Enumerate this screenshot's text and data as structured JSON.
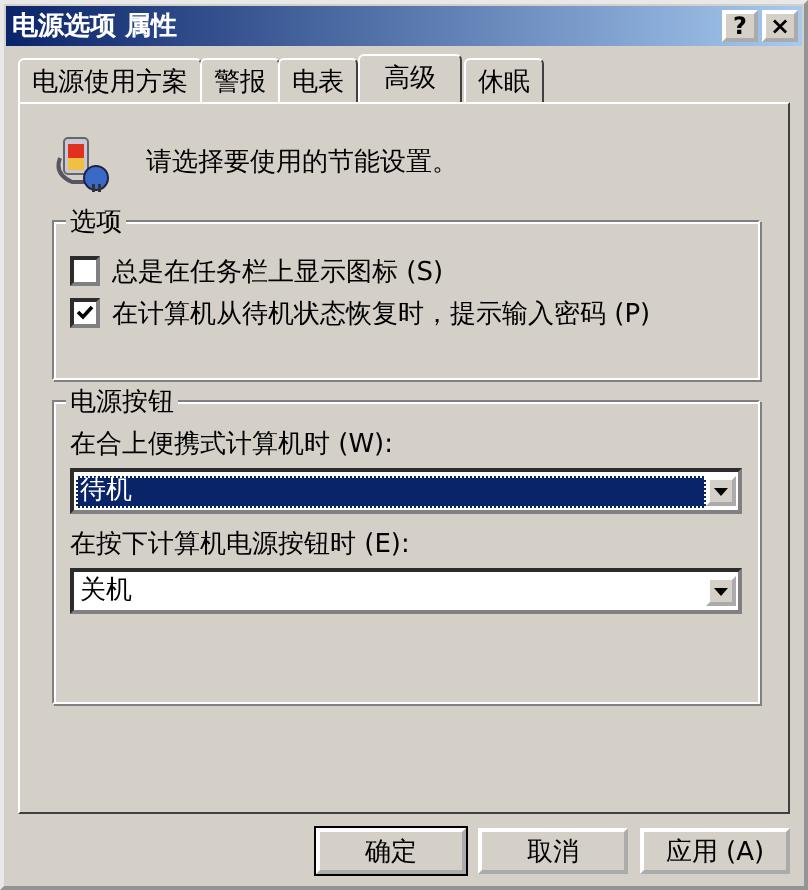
{
  "window": {
    "title": "电源选项 属性",
    "help_button": "?",
    "close_button": "×"
  },
  "tabs": [
    {
      "label": "电源使用方案",
      "selected": false
    },
    {
      "label": "警报",
      "selected": false
    },
    {
      "label": "电表",
      "selected": false
    },
    {
      "label": "高级",
      "selected": true
    },
    {
      "label": "休眠",
      "selected": false
    }
  ],
  "intro": "请选择要使用的节能设置。",
  "options_group": {
    "title": "选项",
    "items": [
      {
        "label": "总是在任务栏上显示图标 (S)",
        "checked": false
      },
      {
        "label": "在计算机从待机状态恢复时，提示输入密码 (P)",
        "checked": true
      }
    ]
  },
  "power_buttons_group": {
    "title": "电源按钮",
    "items": [
      {
        "label": "在合上便携式计算机时 (W):",
        "value": "待机",
        "focused": true
      },
      {
        "label": "在按下计算机电源按钮时 (E):",
        "value": "关机",
        "focused": false
      }
    ]
  },
  "buttons": [
    {
      "label": "确定",
      "default": true
    },
    {
      "label": "取消",
      "default": false
    },
    {
      "label": "应用 (A)",
      "default": false
    }
  ]
}
